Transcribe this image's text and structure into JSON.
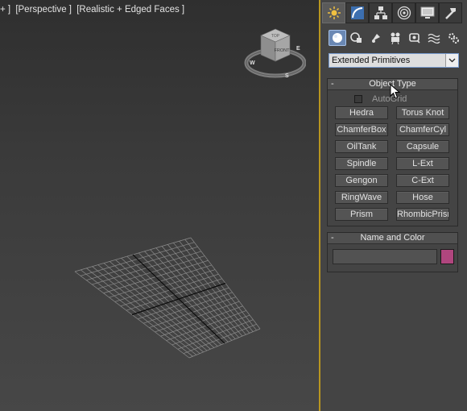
{
  "viewport": {
    "labels": [
      "+ ]",
      "[Perspective ]",
      "[Realistic + Edged Faces ]"
    ],
    "viewcube": {
      "top_face": "TOP",
      "front_face": "FRONT",
      "compass": [
        "W",
        "E",
        "S"
      ]
    }
  },
  "command_panel": {
    "tabs": [
      {
        "name": "create-tab-icon"
      },
      {
        "name": "modify-tab-icon"
      },
      {
        "name": "hierarchy-tab-icon"
      },
      {
        "name": "motion-tab-icon"
      },
      {
        "name": "display-tab-icon"
      },
      {
        "name": "utilities-tab-icon"
      }
    ],
    "subcategories": [
      {
        "name": "geometry-icon"
      },
      {
        "name": "shapes-icon"
      },
      {
        "name": "lights-icon"
      },
      {
        "name": "cameras-icon"
      },
      {
        "name": "helpers-icon"
      },
      {
        "name": "space-warps-icon"
      },
      {
        "name": "systems-icon"
      }
    ],
    "dropdown": {
      "selected": "Extended Primitives"
    },
    "object_type": {
      "title": "Object Type",
      "collapse": "-",
      "autogrid_label": "AutoGrid",
      "autogrid_checked": false,
      "buttons": [
        "Hedra",
        "Torus Knot",
        "ChamferBox",
        "ChamferCyl",
        "OilTank",
        "Capsule",
        "Spindle",
        "L-Ext",
        "Gengon",
        "C-Ext",
        "RingWave",
        "Hose",
        "Prism",
        "RhombicPrism"
      ]
    },
    "name_and_color": {
      "title": "Name and Color",
      "collapse": "-",
      "name_value": "",
      "color": "#b0467e"
    }
  },
  "colors": {
    "viewport_active_border": "#b89620",
    "accent_selected": "#6a88b4"
  }
}
